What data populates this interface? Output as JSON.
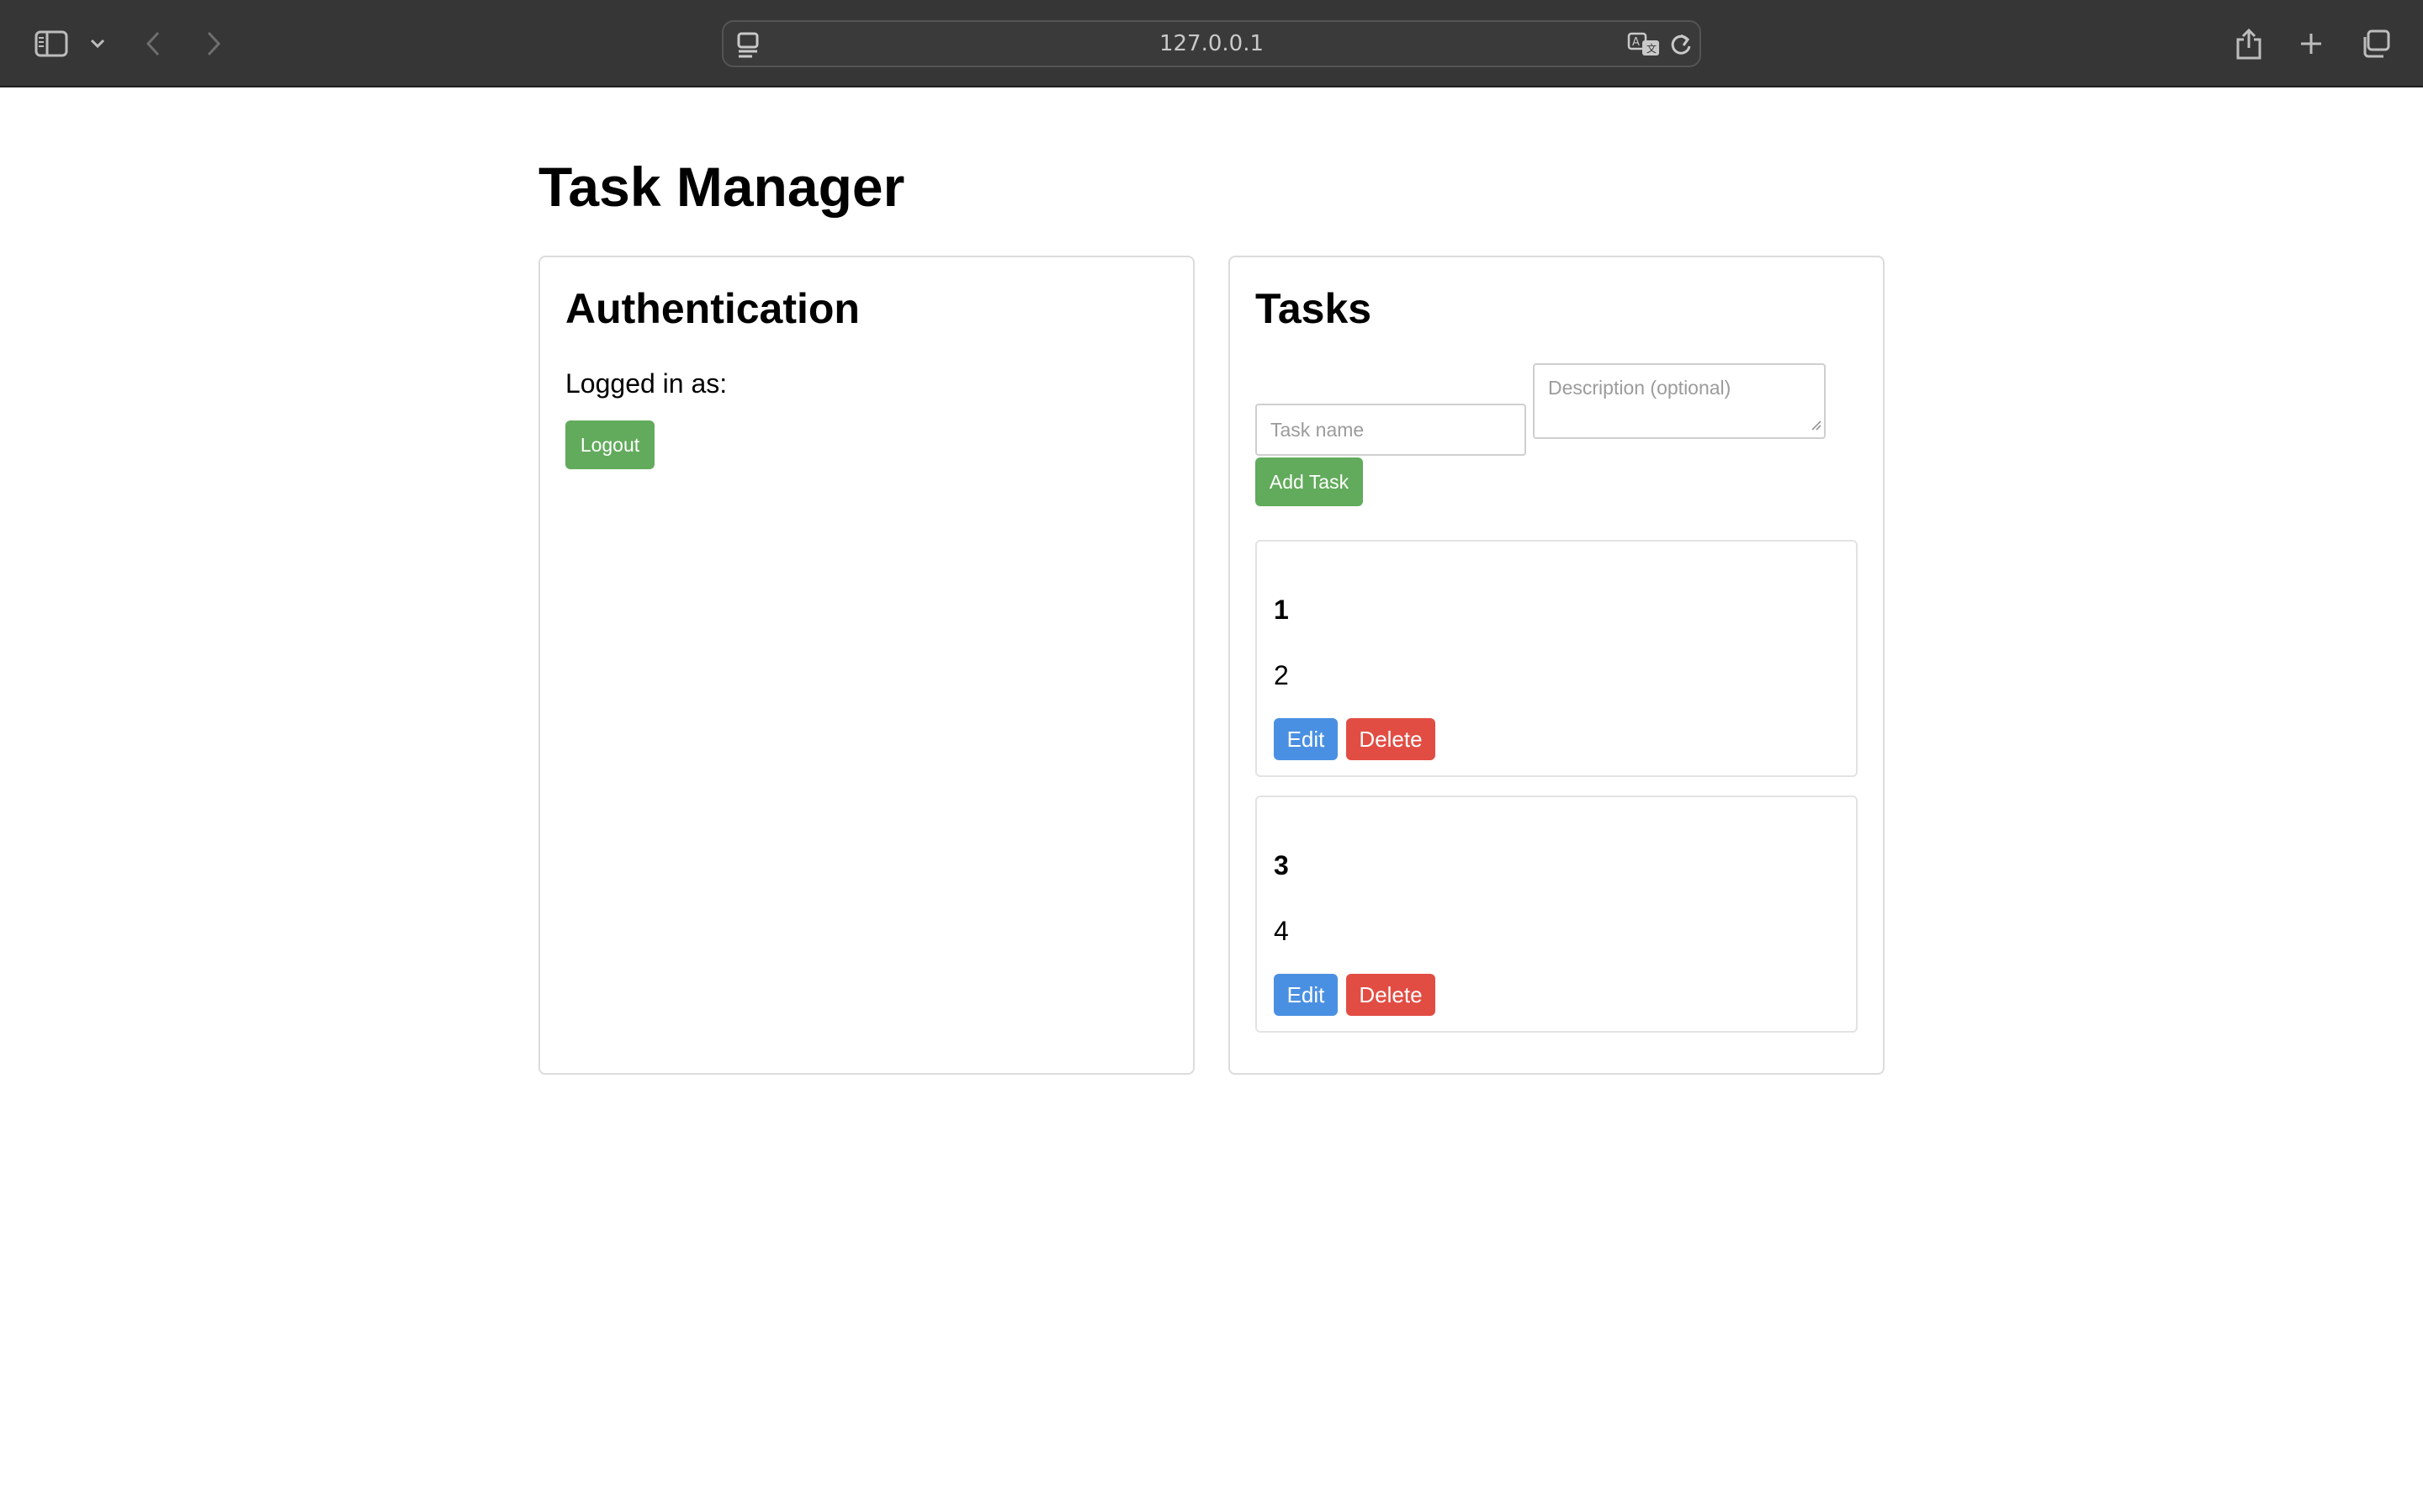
{
  "browser": {
    "url": "127.0.0.1",
    "icons": {
      "sidebar": "sidebar-icon",
      "chevron": "chevron-down-icon",
      "back": "back-arrow-icon",
      "forward": "forward-arrow-icon",
      "page_menu": "page-menu-icon",
      "translate": "translate-icon",
      "reload": "reload-icon",
      "share": "share-icon",
      "new_tab": "plus-icon",
      "tabs": "tabs-overview-icon"
    }
  },
  "page": {
    "title": "Task Manager"
  },
  "auth": {
    "title": "Authentication",
    "logged_in_label": "Logged in as:",
    "logout_label": "Logout"
  },
  "tasks": {
    "title": "Tasks",
    "name_placeholder": "Task name",
    "description_placeholder": "Description (optional)",
    "add_label": "Add Task",
    "items": [
      {
        "name": "1",
        "description": "2",
        "edit_label": "Edit",
        "delete_label": "Delete"
      },
      {
        "name": "3",
        "description": "4",
        "edit_label": "Edit",
        "delete_label": "Delete"
      }
    ]
  },
  "colors": {
    "toolbar": "#363636",
    "green": "#62ab5c",
    "blue": "#4a90e2",
    "red": "#e14d43"
  }
}
